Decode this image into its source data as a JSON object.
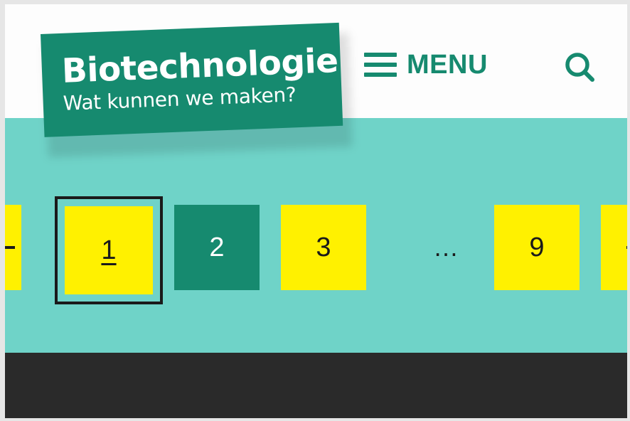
{
  "site": {
    "title": "Biotechnologie",
    "subtitle": "Wat kunnen we maken?"
  },
  "header": {
    "menu_label": "MENU",
    "menu_icon": "hamburger-icon",
    "search_icon": "search-icon"
  },
  "pagination": {
    "pages": [
      "1",
      "2",
      "3",
      "9"
    ],
    "ellipsis": "…",
    "current": "1",
    "prev_icon": "previous-arrow-icon",
    "next_icon": "next-arrow-icon"
  },
  "colors": {
    "brand_green": "#168a6f",
    "band_teal": "#6fd3c8",
    "page_yellow": "#fff100",
    "footer_dark": "#2a2a2a"
  }
}
